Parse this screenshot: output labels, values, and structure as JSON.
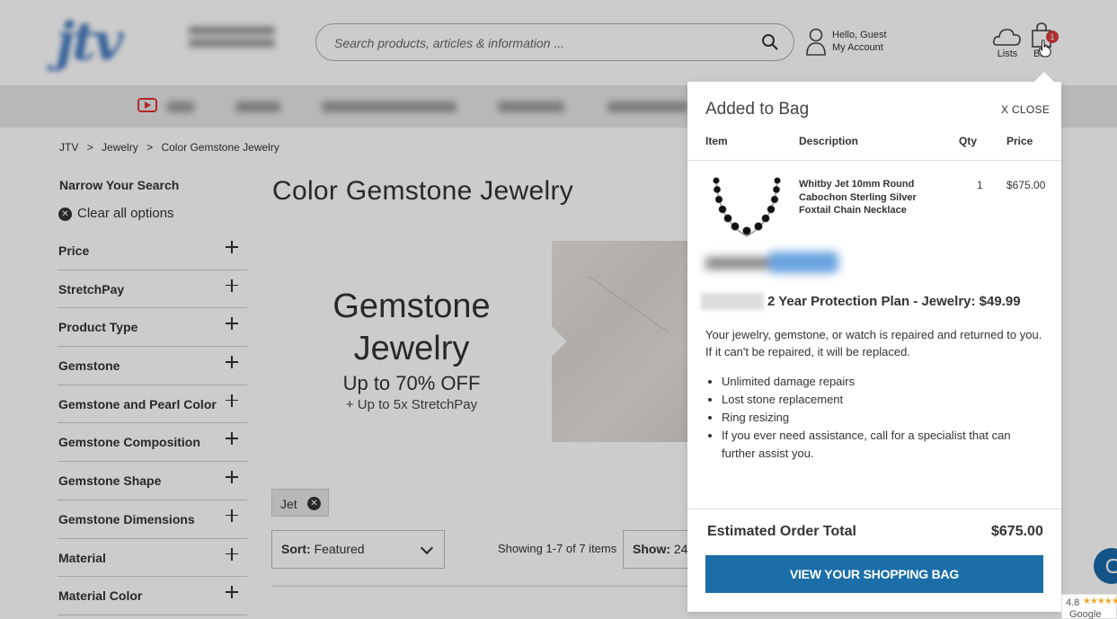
{
  "header": {
    "search_placeholder": "Search products, articles & information ...",
    "account_hello": "Hello, Guest",
    "account_label": "My Account",
    "lists_label": "Lists",
    "bag_label": "Ba",
    "bag_count": "1"
  },
  "breadcrumbs": [
    "JTV",
    ">",
    "Jewelry",
    ">",
    "Color Gemstone Jewelry"
  ],
  "sidebar": {
    "narrow_title": "Narrow Your Search",
    "clear_all": "Clear all options",
    "filters": [
      "Price",
      "StretchPay",
      "Product Type",
      "Gemstone",
      "Gemstone and Pearl Color",
      "Gemstone Composition",
      "Gemstone Shape",
      "Gemstone Dimensions",
      "Material",
      "Material Color"
    ]
  },
  "main": {
    "page_title": "Color Gemstone Jewelry",
    "promo_title": "Gemstone Jewelry",
    "promo_off": "Up to 70% OFF",
    "promo_sub": "+ Up to 5x StretchPay",
    "chip_label": "Jet",
    "sort_label": "Sort:",
    "sort_value": "Featured",
    "showing": "Showing 1-7 of 7 items",
    "show_label": "Show:",
    "show_value": "24"
  },
  "popup": {
    "title": "Added to Bag",
    "close_label": "X  CLOSE",
    "col_item": "Item",
    "col_description": "Description",
    "col_qty": "Qty",
    "col_price": "Price",
    "item_description": "Whitby Jet 10mm Round Cabochon Sterling Silver Foxtail Chain Necklace",
    "item_qty": "1",
    "item_price": "$675.00",
    "plan_title": "2 Year Protection Plan - Jewelry: $49.99",
    "plan_desc": "Your jewelry, gemstone, or watch is repaired and returned to you. If it can't be repaired, it will be replaced.",
    "plan_bullets": [
      "Unlimited damage repairs",
      "Lost stone replacement",
      "Ring resizing",
      "If you ever need assistance, call for a specialist that can further assist you."
    ],
    "total_label": "Estimated Order Total",
    "total_value": "$675.00",
    "view_bag_button": "VIEW YOUR SHOPPING BAG"
  },
  "google_badge": {
    "rating": "4.8",
    "stars": "★★★★★",
    "label": "Google"
  },
  "colors": {
    "primary_button": "#1b6ea8",
    "badge_red": "#d63d3d",
    "nav_bg": "#e7e7e7"
  }
}
